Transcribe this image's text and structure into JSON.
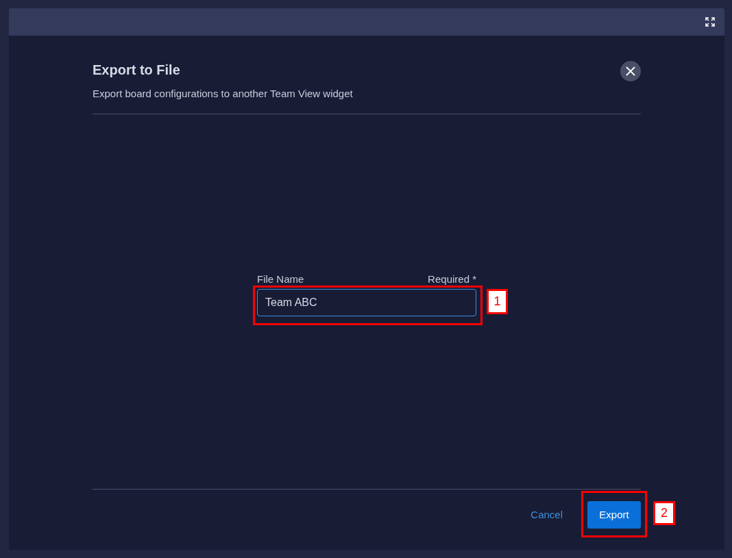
{
  "dialog": {
    "title": "Export to File",
    "subtitle": "Export board configurations to another Team View widget"
  },
  "field": {
    "label": "File Name",
    "required_label": "Required *",
    "value": "Team ABC",
    "focused": true,
    "callout": "1"
  },
  "buttons": [
    {
      "label": "Cancel",
      "kind": "link"
    },
    {
      "label": "Export",
      "kind": "primary",
      "callout": "2"
    }
  ]
}
